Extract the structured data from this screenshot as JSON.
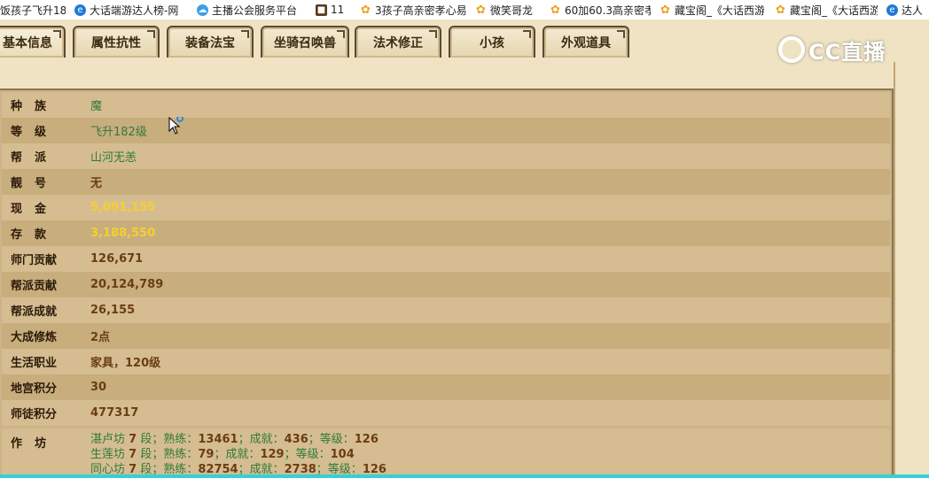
{
  "bookmarks": [
    {
      "label": "饭孩子飞升18",
      "icon": "none"
    },
    {
      "label": "大话端游达人榜-网",
      "icon": "browser-e-icon"
    },
    {
      "label": "主播公会服务平台",
      "icon": "cloud-icon"
    },
    {
      "label": "11",
      "icon": "game-icon"
    },
    {
      "label": "3孩子高亲密孝心易",
      "icon": "chick-icon"
    },
    {
      "label": "微笑哥龙",
      "icon": "chick-icon"
    },
    {
      "label": "60加60.3高亲密孝",
      "icon": "chick-icon"
    },
    {
      "label": "藏宝阁_《大话西游",
      "icon": "chick-icon"
    },
    {
      "label": "藏宝阁_《大话西游",
      "icon": "chick-icon"
    },
    {
      "label": "达人",
      "icon": "browser-e-icon"
    }
  ],
  "tabs": [
    {
      "label": "基本信息",
      "active": true
    },
    {
      "label": "属性抗性",
      "active": false
    },
    {
      "label": "装备法宝",
      "active": false
    },
    {
      "label": "坐骑召唤兽",
      "active": false
    },
    {
      "label": "法术修正",
      "active": false
    },
    {
      "label": "小孩",
      "active": false
    },
    {
      "label": "外观道具",
      "active": false
    }
  ],
  "logo": {
    "text": "CC直播"
  },
  "info_rows": [
    {
      "label": "种族",
      "value": "魔"
    },
    {
      "label": "等级",
      "value": "飞升182级"
    },
    {
      "label": "帮派",
      "value": "山河无恙"
    },
    {
      "label": "靓号",
      "value": "无"
    },
    {
      "label": "现金",
      "value": "5,091,155"
    },
    {
      "label": "存款",
      "value": "3,188,550"
    },
    {
      "label": "师门贡献",
      "value": "126,671"
    },
    {
      "label": "帮派贡献",
      "value": "20,124,789"
    },
    {
      "label": "帮派成就",
      "value": "26,155"
    },
    {
      "label": "大成修炼",
      "value": "2点"
    },
    {
      "label": "生活职业",
      "value": "家具，120级"
    },
    {
      "label": "地宫积分",
      "value": "30"
    },
    {
      "label": "师徒积分",
      "value": "477317"
    }
  ],
  "workshop": {
    "label": "作坊",
    "entries": [
      {
        "name": "湛卢坊",
        "level": "7",
        "duan": "段；熟练：",
        "proficiency": "13461",
        "achievement_label": "；成就：",
        "achievement": "436",
        "grade_label": "；等级：",
        "grade": "126"
      },
      {
        "name": "生莲坊",
        "level": "7",
        "duan": "段；熟练：",
        "proficiency": "79",
        "achievement_label": "；成就：",
        "achievement": "129",
        "grade_label": "；等级：",
        "grade": "104"
      },
      {
        "name": "同心坊",
        "level": "7",
        "duan": "段；熟练：",
        "proficiency": "82754",
        "achievement_label": "；成就：",
        "achievement": "2738",
        "grade_label": "；等级：",
        "grade": "126"
      }
    ]
  },
  "colors": {
    "value_green": "#2f7a3c",
    "value_gold": "#f5d030",
    "value_brown": "#6a3d12",
    "row_light": "#d6bd91",
    "row_dark": "#c8ad7d"
  }
}
